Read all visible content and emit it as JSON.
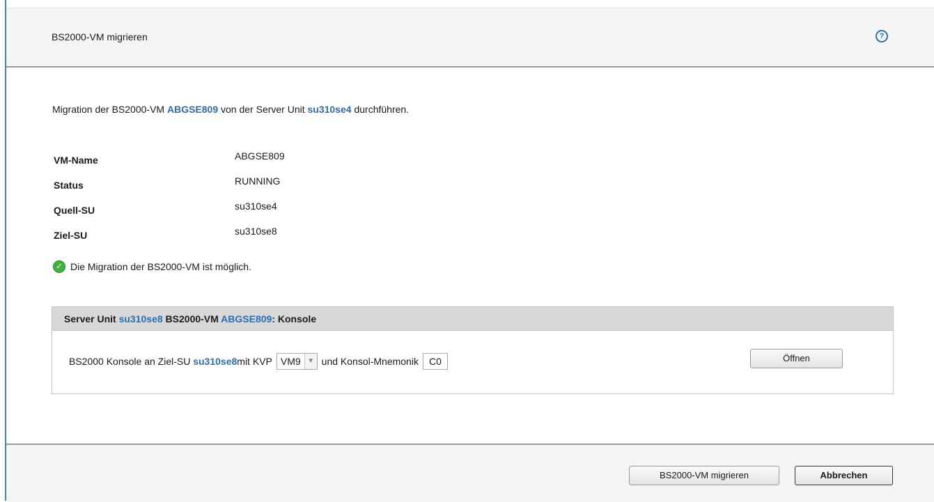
{
  "dialog": {
    "title": "BS2000-VM migrieren",
    "help_icon": "help-icon"
  },
  "intro": {
    "prefix": "Migration der BS2000-VM ",
    "vm": "ABGSE809",
    "middle": " von der Server Unit ",
    "su": "su310se4",
    "suffix": " durchführen."
  },
  "properties": [
    {
      "label": "VM-Name",
      "value": "ABGSE809"
    },
    {
      "label": "Status",
      "value": "RUNNING"
    },
    {
      "label": "Quell-SU",
      "value": "su310se4"
    },
    {
      "label": "Ziel-SU",
      "value": "su310se8"
    }
  ],
  "status_message": {
    "icon": "check-circle-icon",
    "text": "Die Migration der BS2000-VM ist möglich."
  },
  "console_panel": {
    "header": {
      "prefix": "Server Unit ",
      "su": "su310se8",
      "middle": " BS2000-VM ",
      "vm": "ABGSE809",
      "suffix": ": Konsole"
    },
    "row": {
      "prefix": "BS2000 Konsole an Ziel-SU ",
      "su": "su310se8",
      "kvp_label": " mit KVP",
      "kvp_value": "VM9",
      "mnemonic_label": "und Konsol-Mnemonik",
      "mnemonic_value": "C0",
      "open_button": "Öffnen"
    }
  },
  "footer": {
    "migrate_button": "BS2000-VM migrieren",
    "cancel_button": "Abbrechen"
  },
  "colors": {
    "link": "#2b6cb0",
    "success": "#3db33d",
    "panel_header": "#d8d8d8"
  }
}
